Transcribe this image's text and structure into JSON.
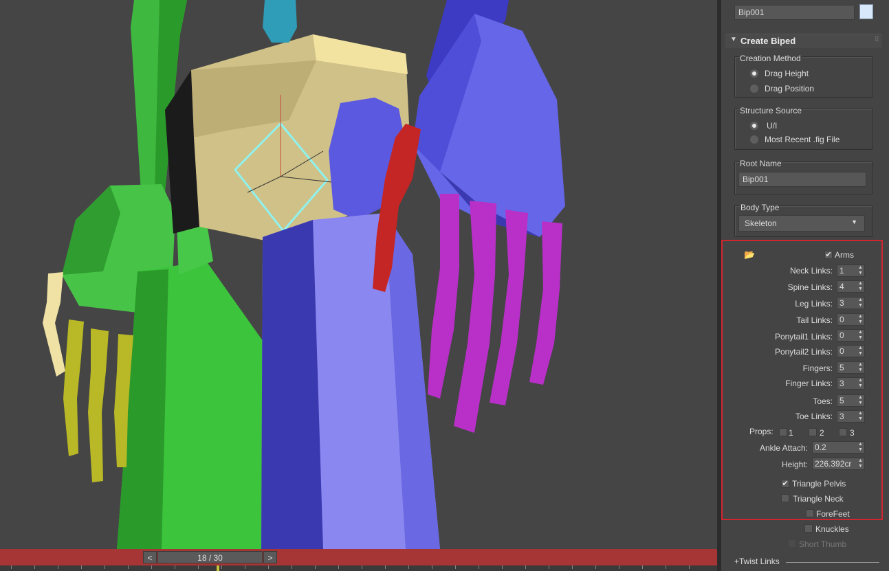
{
  "timeline": {
    "prev_label": "<",
    "next_label": ">",
    "frame_label": "18 / 30"
  },
  "panel": {
    "object_name": "Bip001",
    "object_color": "#d7e8fb",
    "rollout_title": "Create Biped",
    "creation_method": {
      "title": "Creation Method",
      "options": [
        "Drag Height",
        "Drag Position"
      ],
      "selected": "Drag Height"
    },
    "structure_source": {
      "title": "Structure Source",
      "options": [
        "U/I",
        "Most Recent .fig File"
      ],
      "selected": "U/I"
    },
    "root_name": {
      "title": "Root Name",
      "value": "Bip001"
    },
    "body_type": {
      "title": "Body Type",
      "value": "Skeleton"
    },
    "arms": {
      "label": "Arms",
      "checked": true
    },
    "links": {
      "neck": {
        "label": "Neck Links:",
        "value": "1"
      },
      "spine": {
        "label": "Spine Links:",
        "value": "4"
      },
      "leg": {
        "label": "Leg Links:",
        "value": "3"
      },
      "tail": {
        "label": "Tail Links:",
        "value": "0"
      },
      "ponytail1": {
        "label": "Ponytail1 Links:",
        "value": "0"
      },
      "ponytail2": {
        "label": "Ponytail2 Links:",
        "value": "0"
      },
      "fingers": {
        "label": "Fingers:",
        "value": "5"
      },
      "finger_links": {
        "label": "Finger Links:",
        "value": "3"
      },
      "toes": {
        "label": "Toes:",
        "value": "5"
      },
      "toe_links": {
        "label": "Toe Links:",
        "value": "3"
      }
    },
    "props": {
      "label": "Props:",
      "items": [
        "1",
        "2",
        "3"
      ]
    },
    "ankle_attach": {
      "label": "Ankle Attach:",
      "value": "0.2"
    },
    "height": {
      "label": "Height:",
      "value": "226.392cr"
    },
    "triangle_pelvis": {
      "label": "Triangle Pelvis",
      "checked": true
    },
    "triangle_neck": {
      "label": "Triangle Neck",
      "checked": false
    },
    "forefeet": {
      "label": "ForeFeet",
      "checked": false
    },
    "knuckles": {
      "label": "Knuckles",
      "checked": false
    },
    "short_thumb": {
      "label": "Short Thumb",
      "checked": false,
      "disabled": true
    },
    "twist_links": "+Twist Links"
  },
  "colors": {
    "highlight": "#d2262f",
    "timeline": "#a63535"
  }
}
